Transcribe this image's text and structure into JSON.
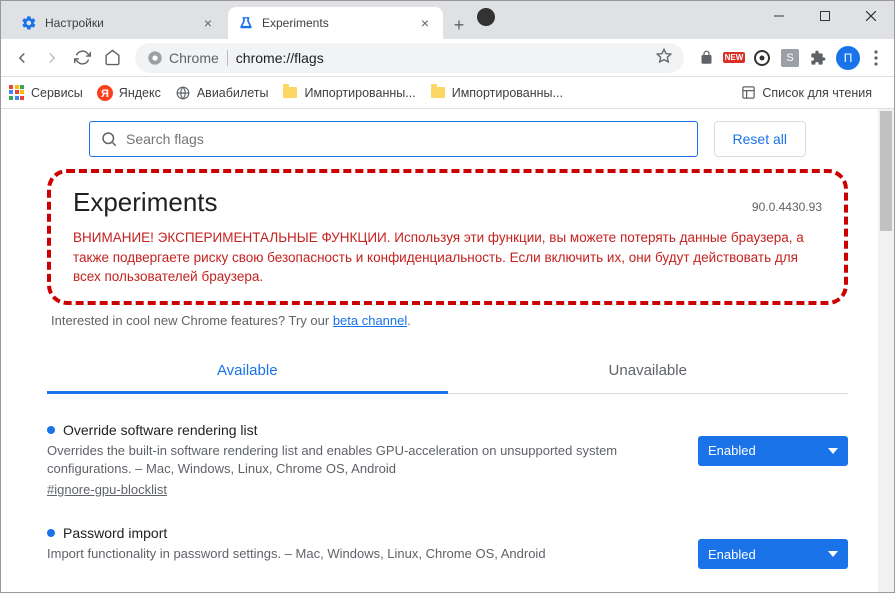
{
  "window": {
    "tabs": [
      {
        "title": "Настройки",
        "icon": "settings"
      },
      {
        "title": "Experiments",
        "icon": "flask"
      }
    ],
    "media_indicator": true
  },
  "toolbar": {
    "site_label": "Chrome",
    "url": "chrome://flags",
    "avatar_letter": "П",
    "ext_icons": [
      "lock",
      "new-badge",
      "circle-dot",
      "s-badge",
      "puzzle"
    ]
  },
  "bookmarks": {
    "items": [
      {
        "icon": "apps",
        "label": "Сервисы"
      },
      {
        "icon": "yandex",
        "label": "Яндекс"
      },
      {
        "icon": "globe",
        "label": "Авиабилеты"
      },
      {
        "icon": "folder",
        "label": "Импортированны..."
      },
      {
        "icon": "folder",
        "label": "Импортированны..."
      }
    ],
    "reading_list": "Список для чтения"
  },
  "page": {
    "search_placeholder": "Search flags",
    "reset_label": "Reset all",
    "title": "Experiments",
    "version": "90.0.4430.93",
    "warning_bold": "ВНИМАНИЕ! ЭКСПЕРИМЕНТАЛЬНЫЕ ФУНКЦИИ.",
    "warning_rest": " Используя эти функции, вы можете потерять данные браузера, а также подвергаете риску свою безопасность и конфиденциальность. Если включить их, они будут действовать для всех пользователей браузера.",
    "beta_prefix": "Interested in cool new Chrome features? Try our ",
    "beta_link": "beta channel",
    "tabs": {
      "available": "Available",
      "unavailable": "Unavailable"
    },
    "flags": [
      {
        "name": "Override software rendering list",
        "desc": "Overrides the built-in software rendering list and enables GPU-acceleration on unsupported system configurations. – Mac, Windows, Linux, Chrome OS, Android",
        "tag": "#ignore-gpu-blocklist",
        "state": "Enabled"
      },
      {
        "name": "Password import",
        "desc": "Import functionality in password settings. – Mac, Windows, Linux, Chrome OS, Android",
        "tag": "",
        "state": "Enabled"
      }
    ]
  }
}
